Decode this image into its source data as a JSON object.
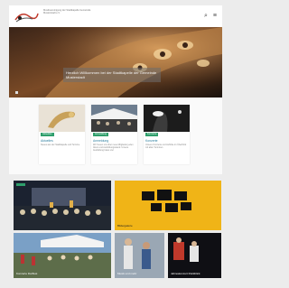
{
  "header": {
    "site_name": "Musikvereinigung der Stadtkapelle Gemeinde Musterstadt e.V.",
    "search_icon": "search-icon",
    "menu_icon": "hamburger-menu-icon"
  },
  "hero": {
    "welcome": "Herzlich Willkommen bei der Stadtkapelle der Gemeinde Musterstadt"
  },
  "cards": [
    {
      "tag": "Aktuelles",
      "title": "Aktuelles",
      "text": "Neues aus der Stadtkapelle und Termine"
    },
    {
      "tag": "Anmeldung",
      "title": "Anmeldung",
      "text": "Wir freuen uns über neue Mitglieder jeden Alters und Ausbildungsstand. Unsere Ausbildung bietet viel"
    },
    {
      "tag": "Konzerte",
      "title": "Konzerte",
      "text": "Unsere Konzerte und Auftritte im Überblick mit allen Terminen"
    }
  ],
  "gallery": [
    {
      "label": ""
    },
    {
      "label": "Bildergalerie"
    },
    {
      "label": "Konzerte Dorffest"
    },
    {
      "label": "Musik und mehr"
    },
    {
      "label": "Jahreskonzert Rückblick"
    }
  ],
  "colors": {
    "accent": "#2e9e6b",
    "yellow": "#f0b417",
    "link": "#2e7fa0"
  }
}
